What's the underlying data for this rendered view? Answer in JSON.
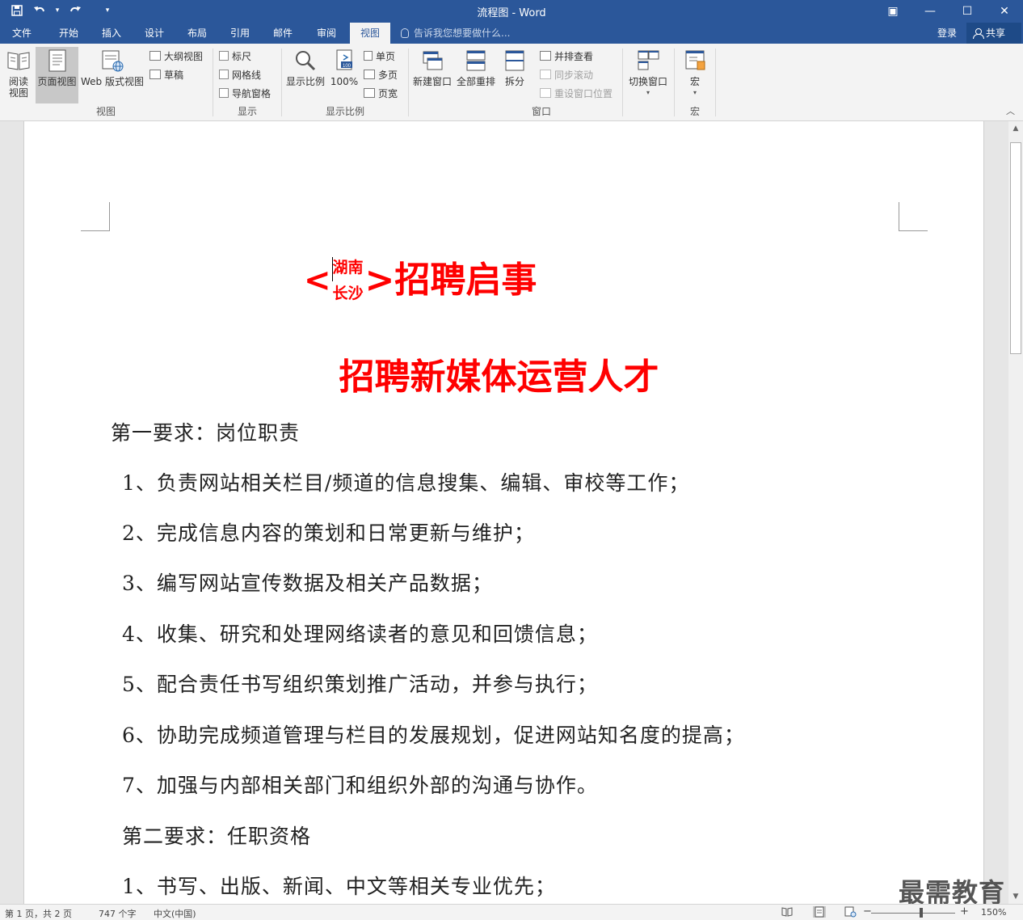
{
  "window": {
    "title": "流程图 - Word",
    "qat": {
      "save_icon": "save-icon",
      "undo_icon": "undo-icon",
      "undo_dropdown": "▾",
      "redo_icon": "redo-icon",
      "customize_icon": "▾"
    },
    "controls": {
      "ribbon_display": "▣",
      "minimize": "—",
      "maximize": "☐",
      "close": "✕"
    }
  },
  "tabs": [
    {
      "label": "文件"
    },
    {
      "label": "开始"
    },
    {
      "label": "插入"
    },
    {
      "label": "设计"
    },
    {
      "label": "布局"
    },
    {
      "label": "引用"
    },
    {
      "label": "邮件"
    },
    {
      "label": "审阅"
    },
    {
      "label": "视图",
      "active": true
    }
  ],
  "tell_me": {
    "placeholder": "告诉我您想要做什么..."
  },
  "account": {
    "login": "登录",
    "share": "共享"
  },
  "ribbon": {
    "views": {
      "label": "视图",
      "read_line1": "阅读",
      "read_line2": "视图",
      "print_layout": "页面视图",
      "web_layout": "Web 版式视图",
      "outline": "大纲视图",
      "draft": "草稿"
    },
    "show": {
      "label": "显示",
      "ruler": "标尺",
      "gridlines": "网格线",
      "nav_pane": "导航窗格"
    },
    "zoom": {
      "label": "显示比例",
      "zoom": "显示比例",
      "hundred": "100%",
      "one_page": "单页",
      "multi_page": "多页",
      "page_width": "页宽"
    },
    "window": {
      "label": "窗口",
      "new_window": "新建窗口",
      "arrange_all": "全部重排",
      "split": "拆分",
      "side_by_side": "并排查看",
      "sync_scroll": "同步滚动",
      "reset_position": "重设窗口位置",
      "switch_windows": "切换窗口"
    },
    "macros": {
      "label": "宏",
      "macros": "宏"
    }
  },
  "document": {
    "head1": {
      "open": "<",
      "combine_top": "湖南",
      "combine_bottom": "长沙",
      "close_title": ">招聘启事"
    },
    "head2": "招聘新媒体运营人才",
    "section1": "第一要求：岗位职责",
    "items": [
      "1、负责网站相关栏目/频道的信息搜集、编辑、审校等工作；",
      "2、完成信息内容的策划和日常更新与维护；",
      "3、编写网站宣传数据及相关产品数据；",
      "4、收集、研究和处理网络读者的意见和回馈信息；",
      "5、配合责任书写组织策划推广活动，并参与执行；",
      "6、协助完成频道管理与栏目的发展规划，促进网站知名度的提高；",
      "7、加强与内部相关部门和组织外部的沟通与协作。"
    ],
    "section2": "第二要求：任职资格",
    "item_s2_1": "1、书写、出版、新闻、中文等相关专业优先；"
  },
  "status": {
    "page": "第 1 页，共 2 页",
    "words": "747 个字",
    "language": "中文(中国)",
    "zoom_minus": "−",
    "zoom_plus": "+",
    "zoom": "150%",
    "zoom_level_percent": 150
  },
  "watermark": "最需教育",
  "colors": {
    "accent": "#2b579a",
    "heading_red": "#ff0000"
  }
}
